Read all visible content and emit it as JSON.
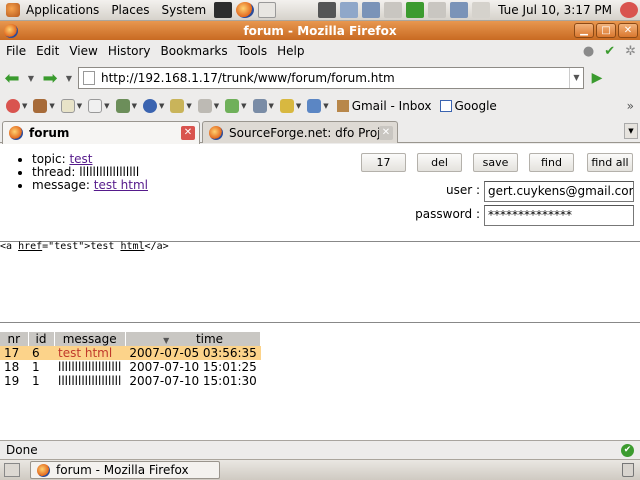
{
  "panel": {
    "menus": [
      "Applications",
      "Places",
      "System"
    ],
    "clock": "Tue Jul 10,  3:17 PM"
  },
  "window": {
    "title": "forum - Mozilla Firefox"
  },
  "menubar": [
    "File",
    "Edit",
    "View",
    "History",
    "Bookmarks",
    "Tools",
    "Help"
  ],
  "nav": {
    "url": "http://192.168.1.17/trunk/www/forum/forum.htm"
  },
  "bookmarks": [
    {
      "label": "Gmail - Inbox",
      "icon": "gmail-icon"
    },
    {
      "label": "Google",
      "icon": "google-icon"
    }
  ],
  "tabs": [
    {
      "label": "forum",
      "active": true
    },
    {
      "label": "SourceForge.net: dfo Project...",
      "active": false
    }
  ],
  "post": {
    "topic_label": "topic: ",
    "topic_value": "test",
    "thread_label": "thread: ",
    "thread_value": "llllllllllllllllll",
    "message_label": "message: ",
    "message_value": "test html"
  },
  "buttons": {
    "nr": "17",
    "del": "del",
    "save": "save",
    "find": "find",
    "find_all": "find all"
  },
  "login": {
    "user_label": "user :",
    "user_value": "gert.cuykens@gmail.com",
    "password_label": "password :",
    "password_value": "**************"
  },
  "source": {
    "part1": "<a ",
    "part2": "href",
    "part3": "=\"test\">test ",
    "part4": "html",
    "part5": "</a>"
  },
  "table": {
    "headers": [
      "nr",
      "id",
      "message",
      "time"
    ],
    "rows": [
      {
        "nr": "17",
        "id": "6",
        "message": "test html",
        "time": "2007-07-05 03:56:35",
        "selected": true
      },
      {
        "nr": "18",
        "id": "1",
        "message": "lllllllllllllllllll",
        "time": "2007-07-10 15:01:25",
        "selected": false
      },
      {
        "nr": "19",
        "id": "1",
        "message": "lllllllllllllllllll",
        "time": "2007-07-10 15:01:30",
        "selected": false
      }
    ]
  },
  "status": {
    "text": "Done"
  },
  "taskbar": {
    "task_label": "forum - Mozilla Firefox"
  },
  "colors": {
    "titlebar": "#d4772d",
    "selected_row": "#fcd38a",
    "link": "#551a8b"
  }
}
